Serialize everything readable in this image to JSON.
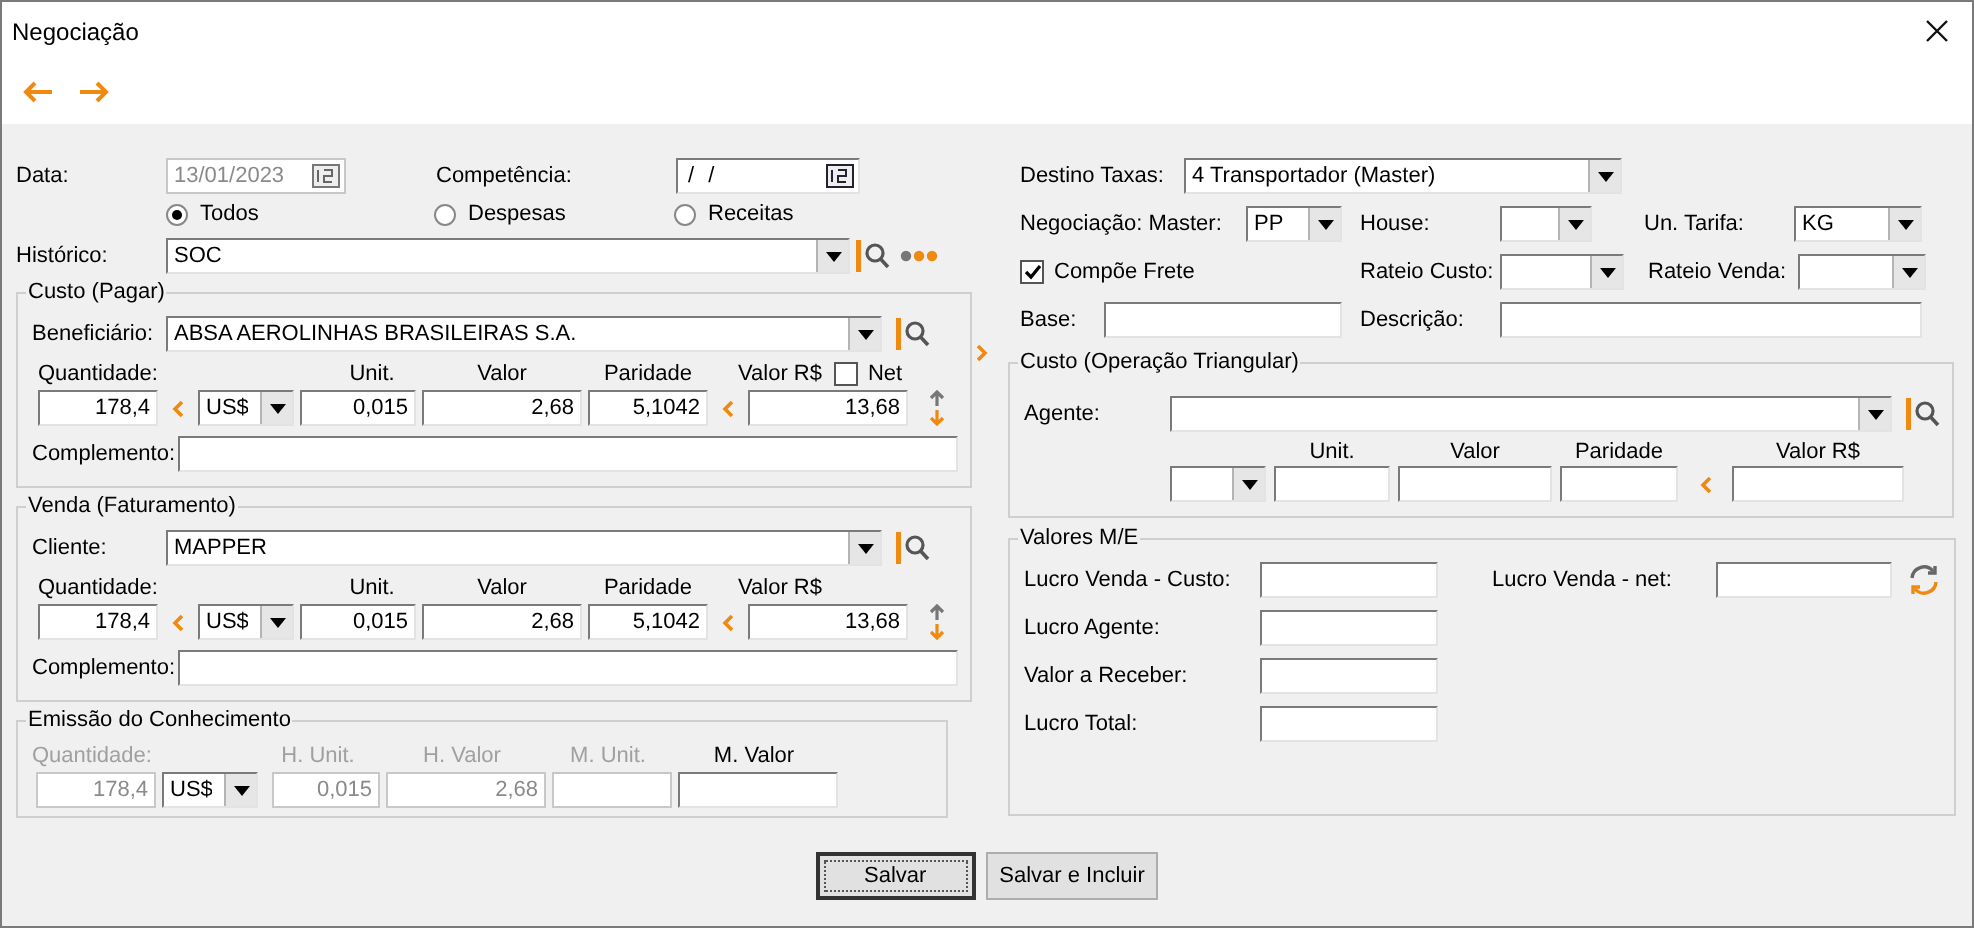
{
  "window": {
    "title": "Negociação"
  },
  "header": {
    "data": {
      "label": "Data:",
      "value": "13/01/2023",
      "disabled": true
    },
    "competencia": {
      "label": "Competência:",
      "value": "/ /",
      "disabled": false
    },
    "filters": [
      {
        "label": "Todos",
        "selected": true
      },
      {
        "label": "Despesas",
        "selected": false
      },
      {
        "label": "Receitas",
        "selected": false
      }
    ],
    "historico": {
      "label": "Histórico:",
      "value": "SOC"
    }
  },
  "custo": {
    "title": "Custo (Pagar)",
    "party_label": "Beneficiário:",
    "party": "ABSA AEROLINHAS BRASILEIRAS S.A.",
    "net": {
      "label": "Net",
      "checked": false
    },
    "columns": [
      "Quantidade:",
      "Unit.",
      "Valor",
      "Paridade",
      "Valor R$"
    ],
    "quantidade": "178,4",
    "moeda": "US$",
    "unit": "0,015",
    "valor": "2,68",
    "paridade": "5,1042",
    "valor_rs": "13,68",
    "complemento_label": "Complemento:"
  },
  "venda": {
    "title": "Venda (Faturamento)",
    "party_label": "Cliente:",
    "party": "MAPPER",
    "columns": [
      "Quantidade:",
      "Unit.",
      "Valor",
      "Paridade",
      "Valor R$"
    ],
    "quantidade": "178,4",
    "moeda": "US$",
    "unit": "0,015",
    "valor": "2,68",
    "paridade": "5,1042",
    "valor_rs": "13,68",
    "complemento_label": "Complemento:"
  },
  "emissao": {
    "title": "Emissão do Conhecimento",
    "columns": [
      {
        "label": "Quantidade:",
        "disabled": true
      },
      {
        "label": "H. Unit.",
        "disabled": true
      },
      {
        "label": "H. Valor",
        "disabled": true
      },
      {
        "label": "M. Unit.",
        "disabled": true
      },
      {
        "label": "M. Valor",
        "disabled": false
      }
    ],
    "quantidade": "178,4",
    "moeda": "US$",
    "h_unit": "0,015",
    "h_valor": "2,68"
  },
  "taxas": {
    "destino_label": "Destino Taxas:",
    "destino": "4 Transportador (Master)",
    "master_label": "Negociação: Master:",
    "master": "PP",
    "house_label": "House:",
    "tarifa_label": "Un. Tarifa:",
    "tarifa": "KG",
    "compoe_frete": {
      "label": "Compõe Frete",
      "checked": true
    },
    "rateio_custo_label": "Rateio Custo:",
    "rateio_venda_label": "Rateio Venda:",
    "base_label": "Base:",
    "descricao_label": "Descrição:"
  },
  "triangular": {
    "title": "Custo (Operação Triangular)",
    "agente_label": "Agente:",
    "columns": [
      "Unit.",
      "Valor",
      "Paridade",
      "Valor R$"
    ]
  },
  "valores": {
    "title": "Valores M/E",
    "rows": [
      {
        "label": "Lucro Venda - Custo:"
      },
      {
        "label": "Lucro Agente:"
      },
      {
        "label": "Valor a Receber:"
      },
      {
        "label": "Lucro Total:"
      }
    ],
    "net_label": "Lucro Venda - net:"
  },
  "buttons": [
    {
      "label": "Salvar",
      "selected": true
    },
    {
      "label": "Salvar e Incluir",
      "selected": false
    }
  ]
}
